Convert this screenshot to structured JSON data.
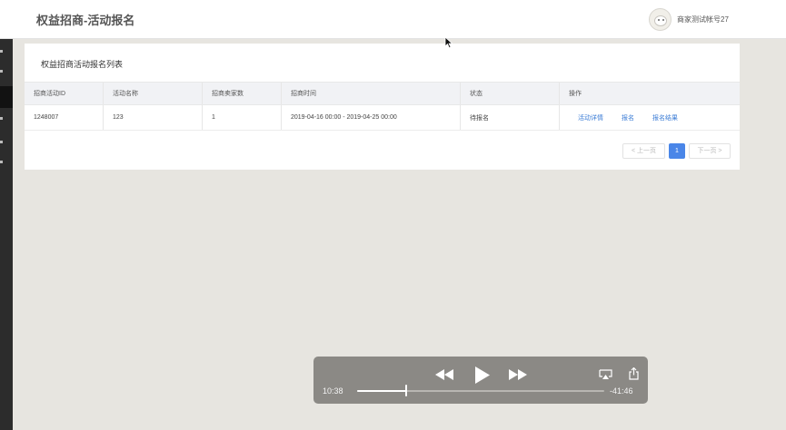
{
  "header": {
    "title": "权益招商-活动报名",
    "user_name": "商家测试帐号27"
  },
  "panel": {
    "title": "权益招商活动报名列表"
  },
  "table": {
    "columns": [
      "招商活动ID",
      "活动名称",
      "招商卖家数",
      "招商时间",
      "状态",
      "操作"
    ],
    "rows": [
      {
        "id": "1248007",
        "name": "123",
        "seller_count": "1",
        "time_range": "2019-04-16 00:00 - 2019-04-25 00:00",
        "status": "待报名",
        "actions": [
          "活动详情",
          "报名",
          "报名结果"
        ]
      }
    ]
  },
  "pagination": {
    "prev_label": "< 上一页",
    "current_page": "1",
    "next_label": "下一页 >"
  },
  "video_player": {
    "elapsed": "10:38",
    "remaining": "-41:46",
    "progress_fraction": 0.2,
    "icons": [
      "rewind-icon",
      "play-icon",
      "fast-forward-icon",
      "airplay-icon",
      "share-icon"
    ]
  },
  "colors": {
    "accent": "#4a86e8",
    "link": "#3b7cd6",
    "sidebar": "#2c2c2c",
    "page_bg": "#e7e5e0",
    "controls_bg": "#8b8985"
  }
}
